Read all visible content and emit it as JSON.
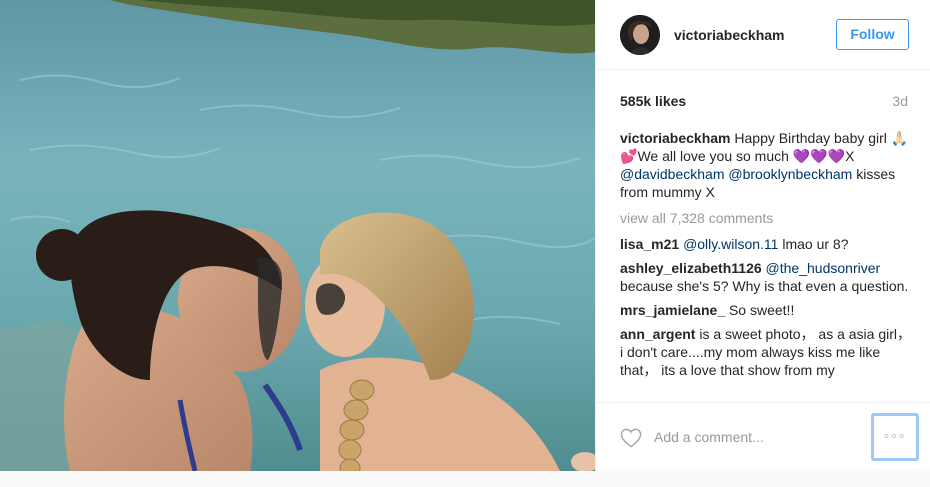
{
  "post": {
    "username": "victoriabeckham",
    "follow_label": "Follow",
    "likes": "585k likes",
    "age": "3d",
    "caption": {
      "author": "victoriabeckham",
      "text1": " Happy Birthday baby girl ",
      "emoji1": "🙏🏻💕",
      "text2": "We all love you so much ",
      "emoji2": "💜💜💜",
      "text3": "X ",
      "mention1": "@davidbeckham",
      "mention2": "@brooklynbeckham",
      "text4": " kisses from mummy X"
    },
    "view_all": "view all 7,328 comments",
    "comments": [
      {
        "author": "lisa_m21",
        "mention": "@olly.wilson.11",
        "text": " lmao ur 8?"
      },
      {
        "author": "ashley_elizabeth1126",
        "mention": "@the_hudsonriver",
        "text": " because she's 5? Why is that even a question."
      },
      {
        "author": "mrs_jamielane_",
        "mention": "",
        "text": " So sweet!!"
      },
      {
        "author": "ann_argent",
        "mention": "",
        "text": " is a sweet photo， as a asia girl，i don't care....my mom always kiss me like that， its a love that show from my"
      }
    ],
    "add_comment_placeholder": "Add a comment...",
    "more_label": "◦◦◦"
  },
  "icons": {
    "like": "heart-icon",
    "more": "more-options-icon"
  },
  "colors": {
    "accent": "#3897f0",
    "highlight": "#9cc9f7",
    "muted": "#999999"
  }
}
